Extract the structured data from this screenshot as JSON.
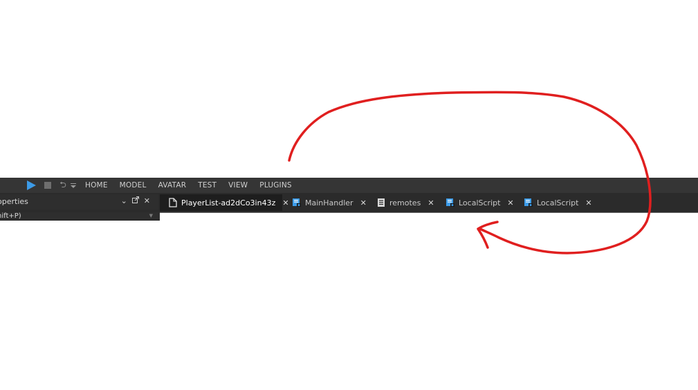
{
  "menubar": {
    "items": [
      "HOME",
      "MODEL",
      "AVATAR",
      "TEST",
      "VIEW",
      "PLUGINS"
    ],
    "quick_access": [
      "play-icon",
      "stop-icon",
      "undo-icon",
      "chevron-down-icon"
    ]
  },
  "properties_panel": {
    "title": "operties",
    "filter_text": "nift+P)"
  },
  "tabs": [
    {
      "label": "PlayerList-ad2dCo3in43z",
      "icon": "document-icon",
      "active": true
    },
    {
      "label": "MainHandler",
      "icon": "script-icon",
      "active": false
    },
    {
      "label": "remotes",
      "icon": "module-script-icon",
      "active": false
    },
    {
      "label": "LocalScript",
      "icon": "script-icon",
      "active": false
    },
    {
      "label": "LocalScript",
      "icon": "script-icon",
      "active": false
    }
  ],
  "colors": {
    "accent_blue": "#3c9be8",
    "annotation_red": "#e01f1f",
    "toolbar_bg": "#353535",
    "tab_active_bg": "#1e1e1e"
  }
}
